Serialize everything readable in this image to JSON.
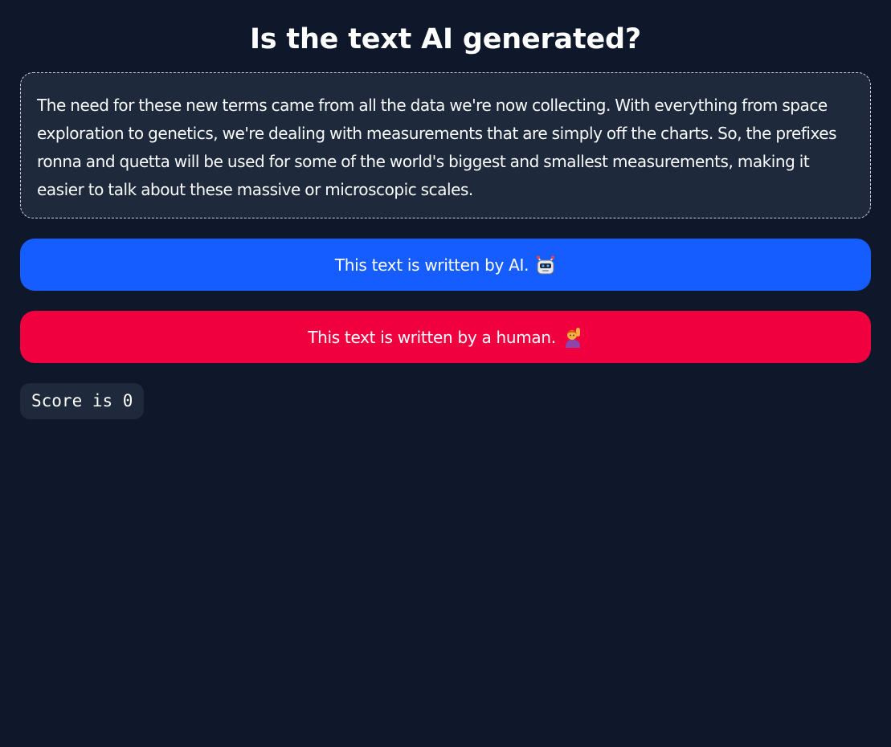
{
  "header": {
    "title": "Is the text AI generated?"
  },
  "passage": {
    "text": "The need for these new terms came from all the data we're now collecting. With everything from space exploration to genetics, we're dealing with measurements that are simply off the charts. So, the prefixes ronna and quetta will be used for some of the world's biggest and smallest measurements, making it easier to talk about these massive or microscopic scales."
  },
  "buttons": {
    "ai_label": "This text is written by AI.",
    "ai_icon": "robot-icon",
    "human_label": "This text is written by a human.",
    "human_icon": "person-raising-hand-icon"
  },
  "score": {
    "label": "Score is 0"
  },
  "colors": {
    "background": "#0f172a",
    "panel": "#1e293b",
    "ai_button": "#165dff",
    "human_button": "#f0003f"
  }
}
